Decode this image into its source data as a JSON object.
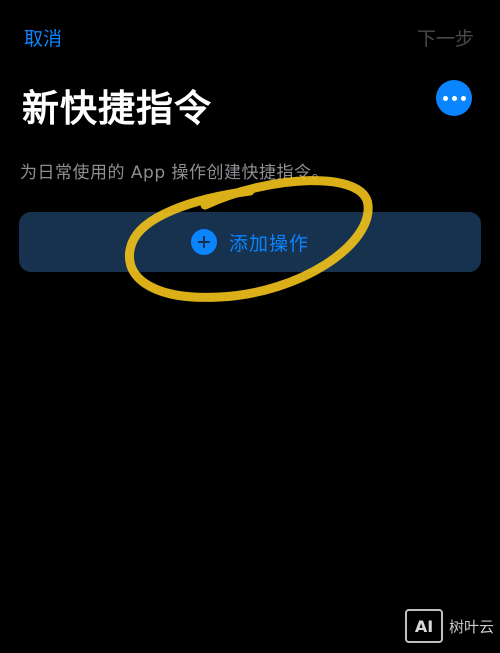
{
  "nav": {
    "cancel_label": "取消",
    "next_label": "下一步"
  },
  "header": {
    "title": "新快捷指令",
    "more_icon": "ellipsis-icon"
  },
  "subtitle": "为日常使用的 App 操作创建快捷指令。",
  "add_action": {
    "label": "添加操作",
    "icon": "plus-circle-icon"
  },
  "watermark": {
    "logo_text": "AI",
    "text": "树叶云"
  },
  "colors": {
    "accent": "#0A84FF",
    "background": "#000000",
    "button_background": "#17324f",
    "disabled_text": "#4a4a4c",
    "secondary_text": "#8e8e93",
    "highlight_ring": "#f2c21b"
  }
}
